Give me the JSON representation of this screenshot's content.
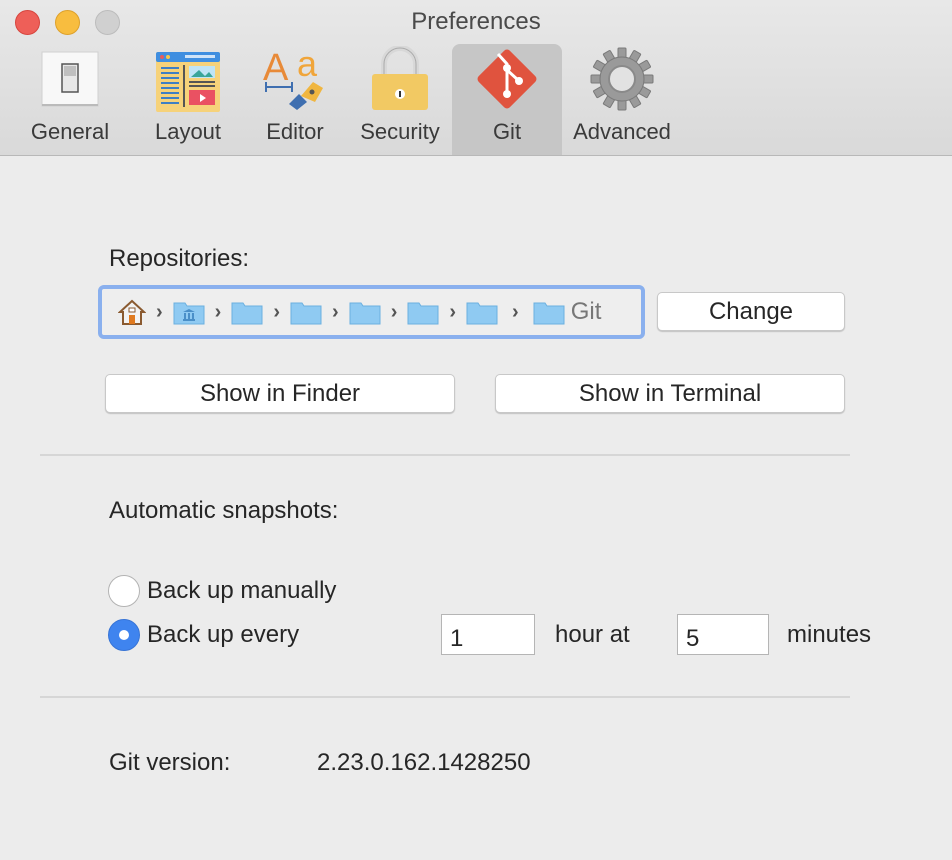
{
  "window": {
    "title": "Preferences"
  },
  "toolbar": {
    "tabs": [
      {
        "label": "General",
        "icon": "light-switch-icon",
        "active": false
      },
      {
        "label": "Layout",
        "icon": "layout-icon",
        "active": false
      },
      {
        "label": "Editor",
        "icon": "font-pen-icon",
        "active": false
      },
      {
        "label": "Security",
        "icon": "padlock-icon",
        "active": false
      },
      {
        "label": "Git",
        "icon": "git-logo-icon",
        "active": true
      },
      {
        "label": "Advanced",
        "icon": "gear-icon",
        "active": false
      }
    ]
  },
  "repositories": {
    "label": "Repositories:",
    "path": {
      "items": [
        "home-folder-icon",
        "library-folder-icon",
        "folder-icon",
        "folder-icon",
        "folder-icon",
        "folder-icon",
        "folder-icon",
        "folder-icon"
      ],
      "last_label": "Git"
    },
    "change_label": "Change",
    "show_in_finder_label": "Show in Finder",
    "show_in_terminal_label": "Show in Terminal"
  },
  "snapshots": {
    "label": "Automatic snapshots:",
    "manual_label": "Back up manually",
    "every_label": "Back up every",
    "selected": "every",
    "hours_value": "1",
    "hour_at_label": "hour at",
    "minutes_value": "5",
    "minutes_label": "minutes"
  },
  "git_version": {
    "label": "Git version:",
    "value": "2.23.0.162.1428250"
  },
  "colors": {
    "accent": "#3f84ef",
    "path_focus": "#8ab0ee",
    "git_red": "#e0533e"
  }
}
